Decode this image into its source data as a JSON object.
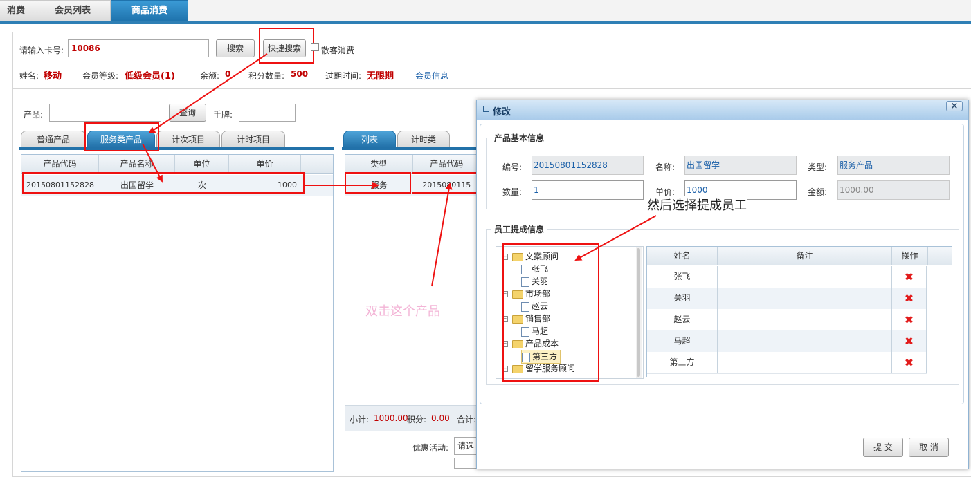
{
  "top_tabs": [
    "消费",
    "会员列表",
    "商品消费"
  ],
  "search": {
    "card_label": "请输入卡号:",
    "card_value": "10086",
    "search_button": "搜索",
    "quick_search_button": "快捷搜索",
    "walk_in_label": "散客消费"
  },
  "member": {
    "name_label": "姓名:",
    "name_value": "移动",
    "level_label": "会员等级:",
    "level_value": "低级会员(1)",
    "balance_label": "余额:",
    "balance_value": "0",
    "points_label": "积分数量:",
    "points_value": "500",
    "expiry_label": "过期时间:",
    "expiry_value": "无限期",
    "info_link": "会员信息"
  },
  "product_filter": {
    "product_label": "产品:",
    "query_button": "查询",
    "plate_label": "手牌:"
  },
  "product_tabs": [
    "普通产品",
    "服务类产品",
    "计次项目",
    "计时项目"
  ],
  "product_table": {
    "headers": [
      "产品代码",
      "产品名称",
      "单位",
      "单价"
    ],
    "rows": [
      {
        "code": "20150801152828",
        "name": "出国留学",
        "unit": "次",
        "price": "1000"
      }
    ]
  },
  "cart_tabs": [
    "列表",
    "计时类"
  ],
  "cart_table": {
    "headers": [
      "类型",
      "产品代码"
    ],
    "rows": [
      {
        "type": "服务",
        "code": "2015080115"
      }
    ]
  },
  "summary": {
    "subtotal_label": "小计:",
    "subtotal_value": "1000.00",
    "points_label": "积分:",
    "points_value": "0.00",
    "total_label": "合计:",
    "promo_label": "优惠活动:",
    "promo_value": "请选"
  },
  "annotations": {
    "select_product": "双击这个产品",
    "select_employee": "然后选择提成员工"
  },
  "modal": {
    "title": "修改",
    "close": "×",
    "basic_legend": "产品基本信息",
    "code_label": "编号:",
    "code_value": "20150801152828",
    "name_label": "名称:",
    "name_value": "出国留学",
    "type_label": "类型:",
    "type_value": "服务产品",
    "qty_label": "数量:",
    "qty_value": "1",
    "price_label": "单价:",
    "price_value": "1000",
    "amount_label": "金额:",
    "amount_value": "1000.00",
    "commission_legend": "员工提成信息",
    "tree": [
      {
        "kind": "folder",
        "label": "文案顾问"
      },
      {
        "kind": "leaf",
        "label": "张飞"
      },
      {
        "kind": "leaf",
        "label": "关羽"
      },
      {
        "kind": "folder",
        "label": "市场部"
      },
      {
        "kind": "leaf",
        "label": "赵云"
      },
      {
        "kind": "folder",
        "label": "销售部"
      },
      {
        "kind": "leaf",
        "label": "马超"
      },
      {
        "kind": "folder",
        "label": "产品成本"
      },
      {
        "kind": "leaf",
        "label": "第三方"
      },
      {
        "kind": "folder",
        "label": "留学服务顾问"
      }
    ],
    "emp_headers": [
      "姓名",
      "备注",
      "操作"
    ],
    "employees": [
      "张飞",
      "关羽",
      "赵云",
      "马超",
      "第三方"
    ],
    "submit": "提 交",
    "cancel": "取 消"
  }
}
